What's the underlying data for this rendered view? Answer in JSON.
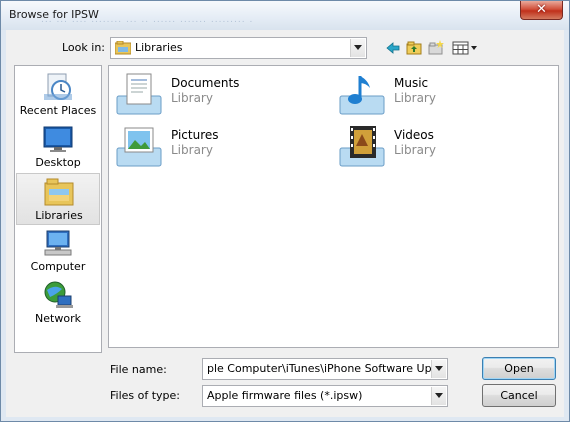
{
  "window": {
    "title": "Browse for IPSW",
    "blur_text": "... ... .... ........ ... .. ...... ....... ......... .",
    "close_label": "✕"
  },
  "toolbar": {
    "lookin_label": "Look in:",
    "lookin_value": "Libraries",
    "icons": [
      "back-arrow-icon",
      "up-folder-icon",
      "new-folder-icon",
      "view-menu-icon"
    ]
  },
  "places": [
    {
      "label": "Recent Places",
      "icon": "recent-places-icon"
    },
    {
      "label": "Desktop",
      "icon": "desktop-icon"
    },
    {
      "label": "Libraries",
      "icon": "libraries-icon",
      "selected": true
    },
    {
      "label": "Computer",
      "icon": "computer-icon"
    },
    {
      "label": "Network",
      "icon": "network-icon"
    }
  ],
  "libraries": [
    {
      "name": "Documents",
      "type": "Library",
      "icon": "documents-library-icon"
    },
    {
      "name": "Music",
      "type": "Library",
      "icon": "music-library-icon"
    },
    {
      "name": "Pictures",
      "type": "Library",
      "icon": "pictures-library-icon"
    },
    {
      "name": "Videos",
      "type": "Library",
      "icon": "videos-library-icon"
    }
  ],
  "filename": {
    "label": "File name:",
    "value": "ple Computer\\iTunes\\iPhone Software Updates"
  },
  "filetype": {
    "label": "Files of type:",
    "value": "Apple firmware files (*.ipsw)"
  },
  "buttons": {
    "open": "Open",
    "cancel": "Cancel"
  },
  "colors": {
    "window_frame": "#dfe8f2",
    "close_red": "#c0301b",
    "dialog_bg": "#f0f0f0",
    "selection": "#e2e2e2"
  }
}
